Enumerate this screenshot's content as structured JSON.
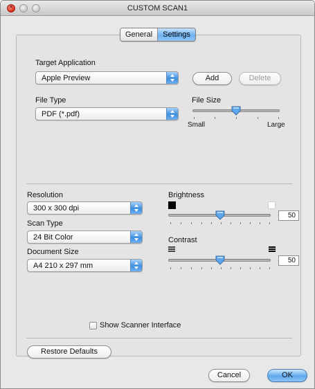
{
  "window": {
    "title": "CUSTOM SCAN1"
  },
  "tabs": [
    {
      "label": "General"
    },
    {
      "label": "Settings"
    }
  ],
  "target_application": {
    "label": "Target Application",
    "value": "Apple Preview",
    "add_label": "Add",
    "delete_label": "Delete"
  },
  "file_type": {
    "label": "File Type",
    "value": "PDF (*.pdf)"
  },
  "file_size": {
    "label": "File Size",
    "min_label": "Small",
    "max_label": "Large",
    "level": 0.5
  },
  "resolution": {
    "label": "Resolution",
    "value": "300 x 300 dpi"
  },
  "scan_type": {
    "label": "Scan Type",
    "value": "24 Bit Color"
  },
  "document_size": {
    "label": "Document Size",
    "value": "A4  210 x 297 mm"
  },
  "brightness": {
    "label": "Brightness",
    "value": "50",
    "level": 0.5
  },
  "contrast": {
    "label": "Contrast",
    "value": "50",
    "level": 0.5
  },
  "show_scanner_interface": {
    "label": "Show Scanner Interface",
    "checked": false
  },
  "footer": {
    "restore_label": "Restore Defaults",
    "cancel_label": "Cancel",
    "ok_label": "OK"
  },
  "colors": {
    "accent_blue": "#5fa9ee",
    "close_red": "#d9301a"
  }
}
